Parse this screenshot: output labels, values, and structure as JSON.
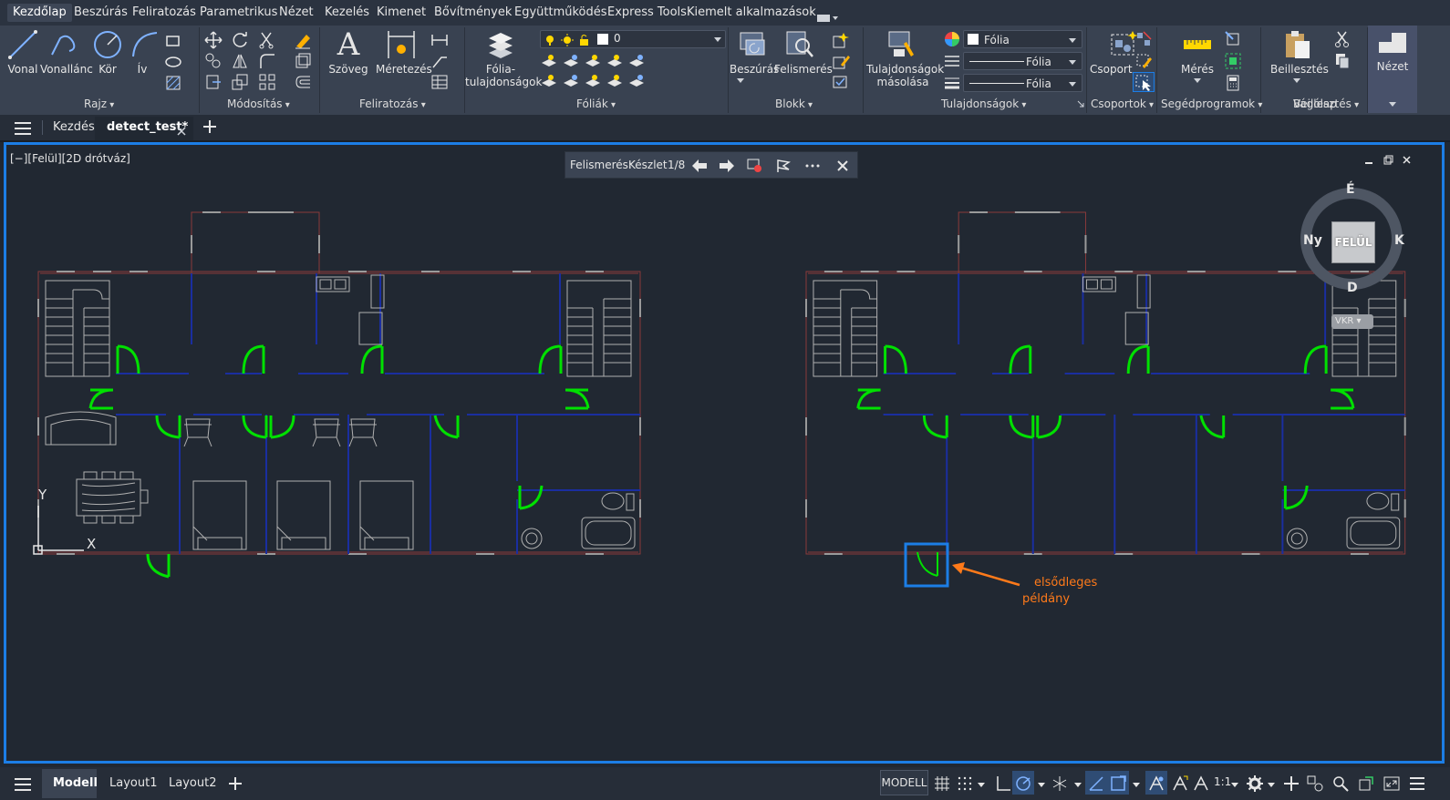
{
  "menubar": {
    "items": [
      "Kezdőlap",
      "Beszúrás",
      "Feliratozás",
      "Parametrikus",
      "Nézet",
      "Kezelés",
      "Kimenet",
      "Bővítmények",
      "Együttműködés",
      "Express Tools",
      "Kiemelt alkalmazások"
    ],
    "active": "Kezdőlap"
  },
  "ribbon": {
    "draw": {
      "line": "Vonal",
      "polyline": "Vonallánc",
      "circle": "Kör",
      "arc": "Ív",
      "title": "Rajz"
    },
    "modify": {
      "title": "Módosítás"
    },
    "annotation": {
      "text": "Szöveg",
      "dimension": "Méretezés",
      "title": "Feliratozás"
    },
    "layers": {
      "properties_line1": "Fólia-",
      "properties_line2": "tulajdonságok",
      "current_layer": "0",
      "title": "Fóliák"
    },
    "block": {
      "insert": "Beszúrás",
      "detect": "Felismerés",
      "title": "Blokk"
    },
    "properties": {
      "match_line1": "Tulajdonságok",
      "match_line2": "másolása",
      "color": "Fólia",
      "linetype": "Fólia",
      "lineweight": "Fólia",
      "title": "Tulajdonságok"
    },
    "groups": {
      "group": "Csoport",
      "title": "Csoportok"
    },
    "utilities": {
      "measure": "Mérés",
      "title": "Segédprogramok"
    },
    "clipboard": {
      "paste": "Beillesztés",
      "title": "Vágólap"
    },
    "view": {
      "view": "Nézet"
    }
  },
  "doctabs": {
    "start": "Kezdés",
    "file": "detect_test*"
  },
  "viewport": {
    "label": "[−][Felül][2D drótváz]",
    "detect_toolbar": {
      "label": "Felismerés:",
      "set": "Készlet",
      "count": "1/8"
    },
    "viewcube": {
      "north": "É",
      "west": "Ny",
      "east": "K",
      "south": "D",
      "top": "FELÜL",
      "wcs": "VKR"
    },
    "ucs": {
      "x": "X",
      "y": "Y"
    },
    "annotation_line1": "elsődleges",
    "annotation_line2": "példány"
  },
  "statusbar": {
    "model_tab": "Modell",
    "layout1": "Layout1",
    "layout2": "Layout2",
    "mode": "MODELL",
    "scale": "1:1"
  },
  "colors": {
    "accent": "#1c7ee6",
    "door": "#00e000",
    "wall": "#8a3a3a",
    "blue_wall": "#1a2ea0",
    "annotation": "#ff7a1a"
  }
}
